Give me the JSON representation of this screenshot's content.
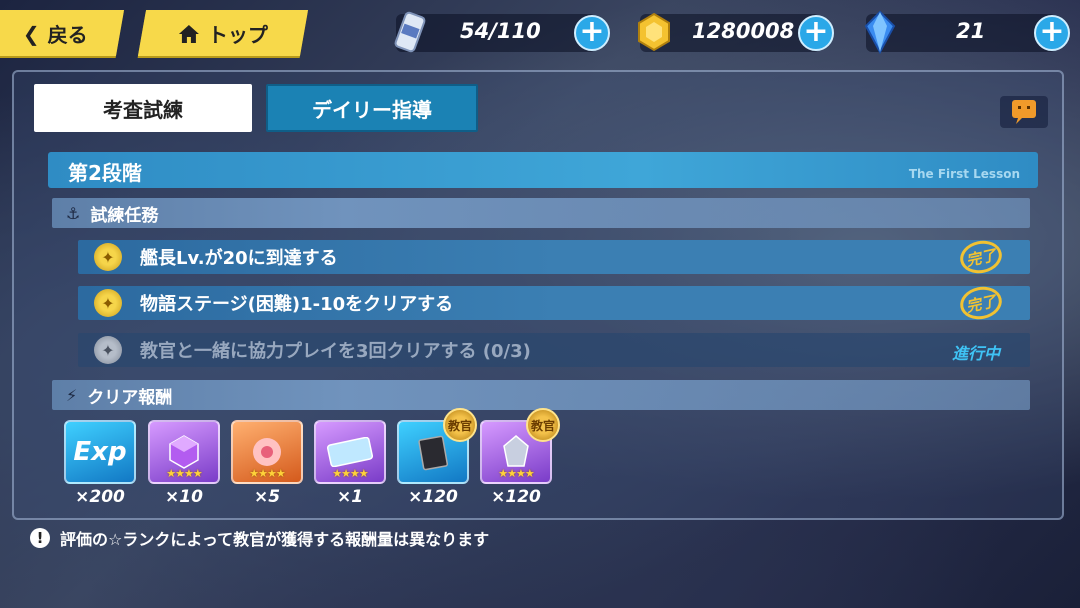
{
  "topbar": {
    "back_label": "戻る",
    "top_label": "トップ",
    "stamina": "54/110",
    "coins": "1280008",
    "crystals": "21"
  },
  "tabs": [
    {
      "label": "考査試練",
      "active": true
    },
    {
      "label": "デイリー指導",
      "active": false
    }
  ],
  "stage": {
    "title": "第2段階",
    "subtitle": "The First Lesson"
  },
  "tasks_section": {
    "header": "試練任務",
    "items": [
      {
        "text": "艦長Lv.が20に到達する",
        "done": true
      },
      {
        "text": "物語ステージ(困難)1-10をクリアする",
        "done": true
      },
      {
        "text": "教官と一緒に協力プレイを3回クリアする (0/3)",
        "done": false,
        "status": "進行中"
      }
    ]
  },
  "rewards_section": {
    "header": "クリア報酬",
    "items": [
      {
        "name": "exp",
        "label": "Exp",
        "qty": "×200",
        "color": "blue",
        "stars": ""
      },
      {
        "name": "cube",
        "label": "",
        "qty": "×10",
        "color": "purple",
        "stars": "★★★★"
      },
      {
        "name": "sakura",
        "label": "",
        "qty": "×5",
        "color": "orange",
        "stars": "★★★★"
      },
      {
        "name": "ticket",
        "label": "",
        "qty": "×1",
        "color": "purple",
        "stars": "★★★★"
      },
      {
        "name": "book",
        "label": "",
        "qty": "×120",
        "color": "blue",
        "stars": "",
        "badge": "教官"
      },
      {
        "name": "emblem",
        "label": "",
        "qty": "×120",
        "color": "purple",
        "stars": "★★★★",
        "badge": "教官"
      }
    ]
  },
  "note": "評価の☆ランクによって教官が獲得する報酬量は異なります",
  "colors": {
    "accent_yellow": "#f7d94a",
    "accent_blue": "#2aa8e8",
    "status_cyan": "#3fc3f5",
    "done_gold": "#f1c232"
  }
}
